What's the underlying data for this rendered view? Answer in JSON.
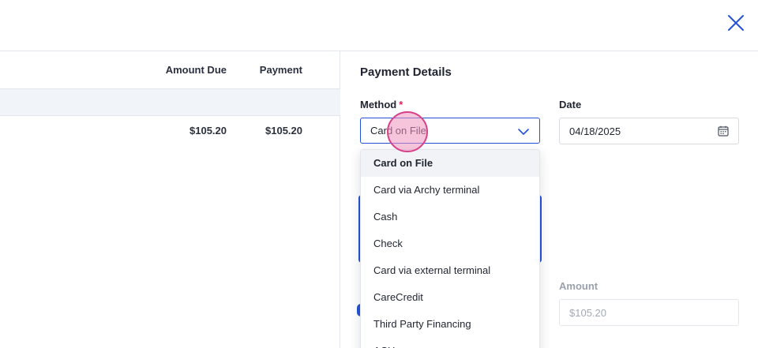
{
  "table": {
    "headers": {
      "amount_due": "Amount Due",
      "payment": "Payment"
    },
    "rows": [
      {
        "amount_due": "$105.20",
        "payment": "$105.20"
      }
    ]
  },
  "payment_details": {
    "title": "Payment Details",
    "method": {
      "label": "Method",
      "required_mark": "*",
      "value": "Card on File",
      "options": [
        "Card on File",
        "Card via Archy terminal",
        "Cash",
        "Check",
        "Card via external terminal",
        "CareCredit",
        "Third Party Financing",
        "ACH"
      ]
    },
    "date": {
      "label": "Date",
      "value": "04/18/2025"
    },
    "amount": {
      "label": "Amount",
      "value": "$105.20"
    }
  },
  "icons": {
    "close": "close-icon",
    "chevron": "chevron-down-icon",
    "calendar": "calendar-icon"
  },
  "colors": {
    "accent": "#2452d6",
    "required": "#e0245e",
    "selected_bg": "#f1f3f6",
    "group_row_bg": "#f1f4f9"
  }
}
